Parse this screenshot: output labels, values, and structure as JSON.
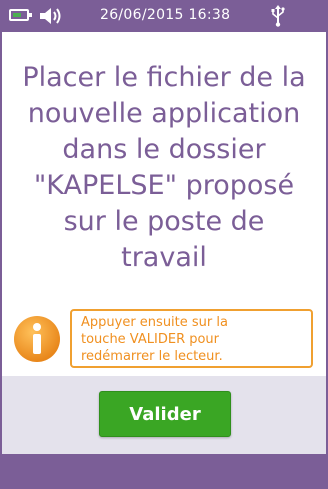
{
  "status_bar": {
    "battery_icon": "battery-icon",
    "sound_icon": "speaker-icon",
    "datetime": "26/06/2015 16:38",
    "usb_icon": "usb-icon"
  },
  "message": {
    "lines": [
      "Placer le fichier de la",
      "nouvelle application",
      "dans le dossier",
      "\"KAPELSE\" proposé",
      "sur le poste de",
      "travail"
    ]
  },
  "info": {
    "icon": "info-icon",
    "lines": [
      "Appuyer ensuite sur la",
      "touche VALIDER pour",
      "redémarrer le lecteur."
    ]
  },
  "validate_button": {
    "label": "Valider"
  },
  "colors": {
    "brand_purple": "#7b5e97",
    "accent_orange": "#f0a030",
    "button_green": "#3aa624",
    "footer_gray": "#e4e2ec"
  }
}
